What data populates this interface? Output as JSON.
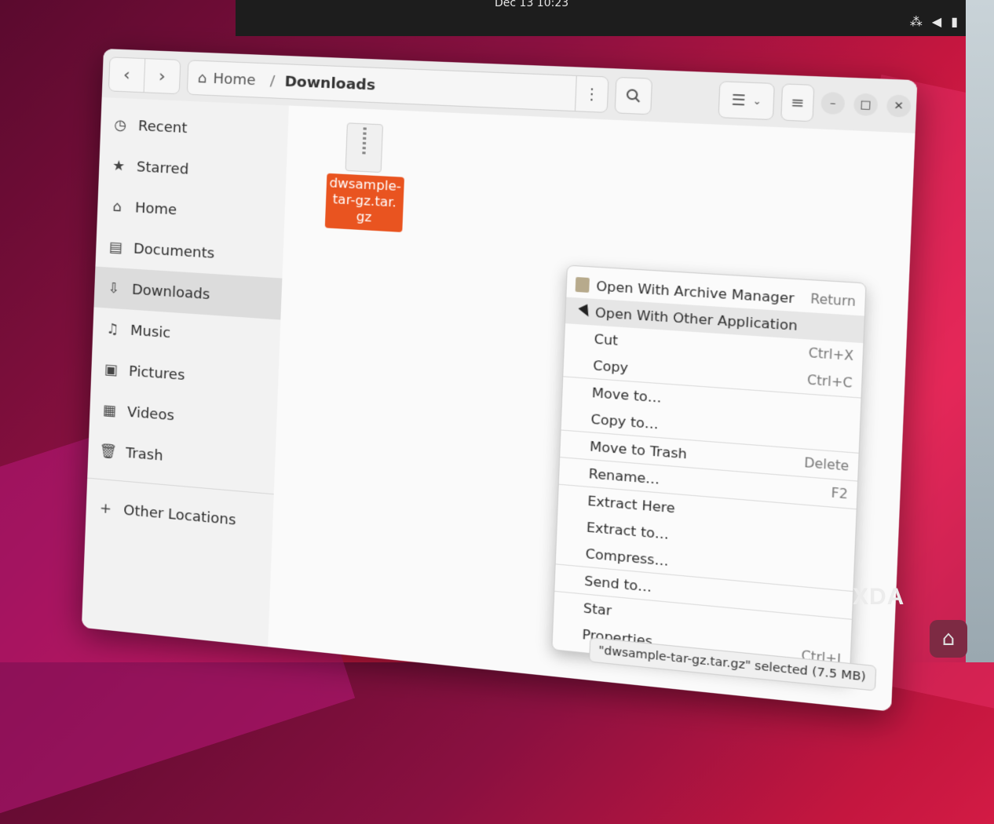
{
  "topbar": {
    "clock": "Dec 13 10:23"
  },
  "header": {
    "path_home": "Home",
    "path_current": "Downloads"
  },
  "sidebar": {
    "items": [
      {
        "label": "Recent",
        "icon": "clock-icon"
      },
      {
        "label": "Starred",
        "icon": "star-icon"
      },
      {
        "label": "Home",
        "icon": "home-icon"
      },
      {
        "label": "Documents",
        "icon": "document-icon"
      },
      {
        "label": "Downloads",
        "icon": "download-icon",
        "active": true
      },
      {
        "label": "Music",
        "icon": "music-icon"
      },
      {
        "label": "Pictures",
        "icon": "picture-icon"
      },
      {
        "label": "Videos",
        "icon": "video-icon"
      },
      {
        "label": "Trash",
        "icon": "trash-icon"
      }
    ],
    "other_locations": "Other Locations"
  },
  "file": {
    "name_line1": "dwsample-",
    "name_line2": "tar-gz.tar.",
    "name_line3": "gz"
  },
  "context_menu": {
    "items": [
      {
        "label": "Open With Archive Manager",
        "accel": "Return"
      },
      {
        "label": "Open With Other Application",
        "accel": ""
      },
      {
        "label": "Cut",
        "accel": "Ctrl+X"
      },
      {
        "label": "Copy",
        "accel": "Ctrl+C"
      },
      {
        "label": "Move to…",
        "accel": ""
      },
      {
        "label": "Copy to…",
        "accel": ""
      },
      {
        "label": "Move to Trash",
        "accel": "Delete"
      },
      {
        "label": "Rename…",
        "accel": "F2"
      },
      {
        "label": "Extract Here",
        "accel": ""
      },
      {
        "label": "Extract to…",
        "accel": ""
      },
      {
        "label": "Compress…",
        "accel": ""
      },
      {
        "label": "Send to…",
        "accel": ""
      },
      {
        "label": "Star",
        "accel": ""
      },
      {
        "label": "Properties",
        "accel": "Ctrl+I"
      }
    ]
  },
  "status": {
    "text": "\"dwsample-tar-gz.tar.gz\" selected (7.5 MB)"
  },
  "watermark": {
    "text": "XDA"
  },
  "colors": {
    "accent": "#e95420",
    "selected_row": "#dcdcdc"
  }
}
